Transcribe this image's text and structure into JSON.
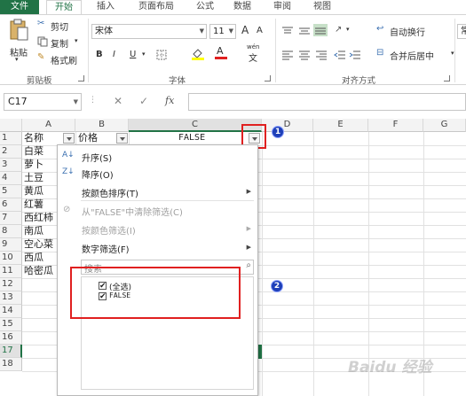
{
  "tabs": [
    "文件",
    "开始",
    "插入",
    "页面布局",
    "公式",
    "数据",
    "审阅",
    "视图"
  ],
  "ribbon": {
    "clipboard": {
      "paste": "粘贴",
      "cut": "剪切",
      "copy": "复制",
      "format_painter": "格式刷",
      "group": "剪贴板"
    },
    "font": {
      "name": "宋体",
      "size": "11",
      "grow": "A",
      "shrink": "A",
      "bold": "B",
      "italic": "I",
      "underline": "U",
      "group": "字体",
      "wen": "wén",
      "wen_char": "文"
    },
    "alignment": {
      "wrap": "自动换行",
      "merge": "合并后居中",
      "group": "对齐方式"
    },
    "number": {
      "format": "常"
    }
  },
  "formula_bar": {
    "name_box": "C17",
    "cancel": "✕",
    "enter": "✓",
    "fx": "fx",
    "value": ""
  },
  "columns": [
    "A",
    "B",
    "C",
    "D",
    "E",
    "F",
    "G"
  ],
  "rows": [
    "1",
    "2",
    "3",
    "4",
    "5",
    "6",
    "7",
    "8",
    "9",
    "10",
    "11",
    "12",
    "13",
    "14",
    "15",
    "16",
    "17",
    "18"
  ],
  "cells": {
    "A": [
      "名称",
      "白菜",
      "萝卜",
      "土豆",
      "黄瓜",
      "红薯",
      "西红柿",
      "南瓜",
      "空心菜",
      "西瓜",
      "哈密瓜"
    ],
    "B1": "价格",
    "C1": "FALSE"
  },
  "menu": {
    "sort_asc": "升序(S)",
    "sort_desc": "降序(O)",
    "sort_color": "按颜色排序(T)",
    "clear_filter": "从\"FALSE\"中清除筛选(C)",
    "filter_color": "按颜色筛选(I)",
    "number_filter": "数字筛选(F)",
    "search_placeholder": "搜索",
    "select_all": "(全选)",
    "item_false": "FALSE"
  },
  "annotations": {
    "badge1": "1",
    "badge2": "2",
    "watermark": "Baidu 经验"
  },
  "colors": {
    "excel_green": "#217346",
    "annotation_red": "#e02020",
    "badge_blue": "#1e3fb8"
  }
}
